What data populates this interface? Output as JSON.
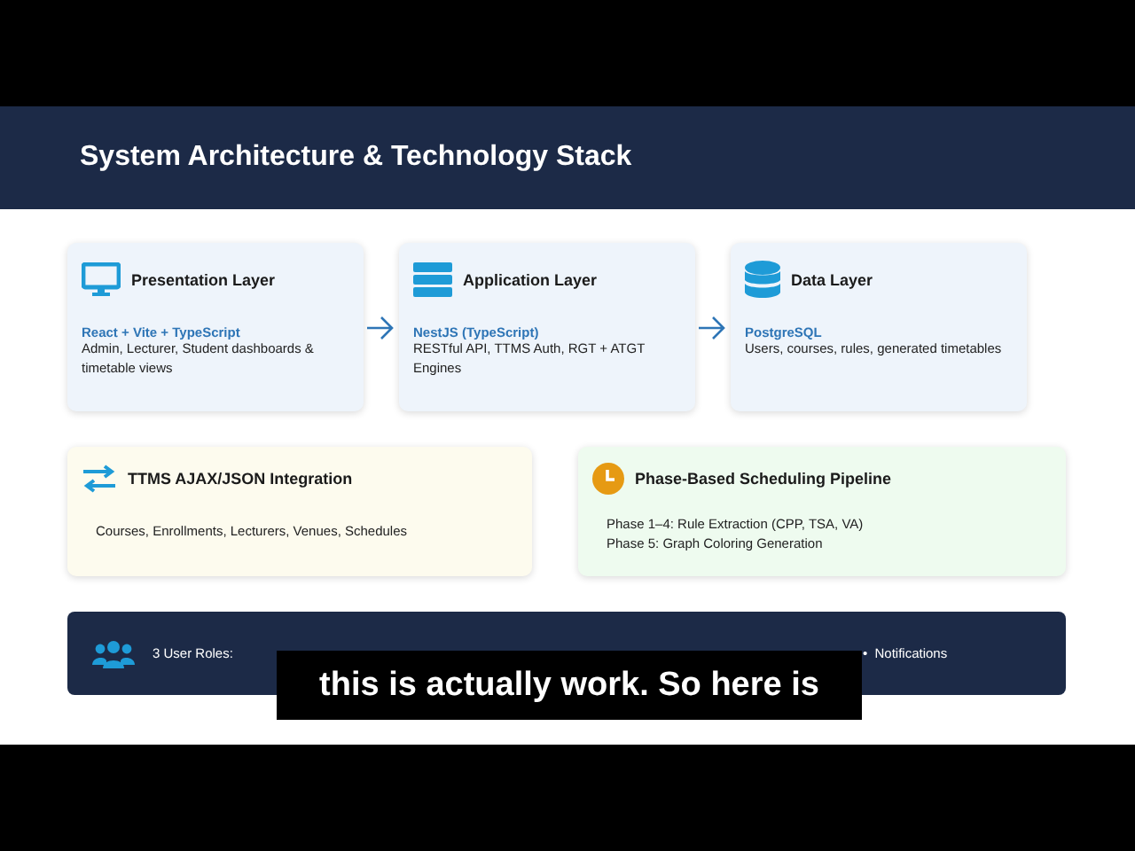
{
  "slide": {
    "title": "System Architecture & Technology Stack",
    "layers": [
      {
        "kind": "monitor",
        "title": "Presentation Layer",
        "tech": "React + Vite + TypeScript",
        "description": "Admin, Lecturer, Student dashboards & timetable views"
      },
      {
        "kind": "server",
        "title": "Application Layer",
        "tech": "NestJS (TypeScript)",
        "description": "RESTful API, TTMS Auth, RGT + ATGT Engines"
      },
      {
        "kind": "database",
        "title": "Data Layer",
        "tech": "PostgreSQL",
        "description": "Users, courses, rules, generated timetables"
      }
    ],
    "panels": [
      {
        "kind": "sync",
        "title": "TTMS AJAX/JSON Integration",
        "lines": [
          "Courses, Enrollments, Lecturers, Venues, Schedules"
        ]
      },
      {
        "kind": "clock",
        "title": "Phase-Based Scheduling Pipeline",
        "lines": [
          "Phase 1–4: Rule Extraction (CPP, TSA, VA)",
          "Phase 5: Graph Coloring Generation"
        ]
      }
    ],
    "footer": {
      "label": "3 User Roles:",
      "tail": "•  Notifications"
    }
  },
  "subtitle": "this is actually work. So here is"
}
